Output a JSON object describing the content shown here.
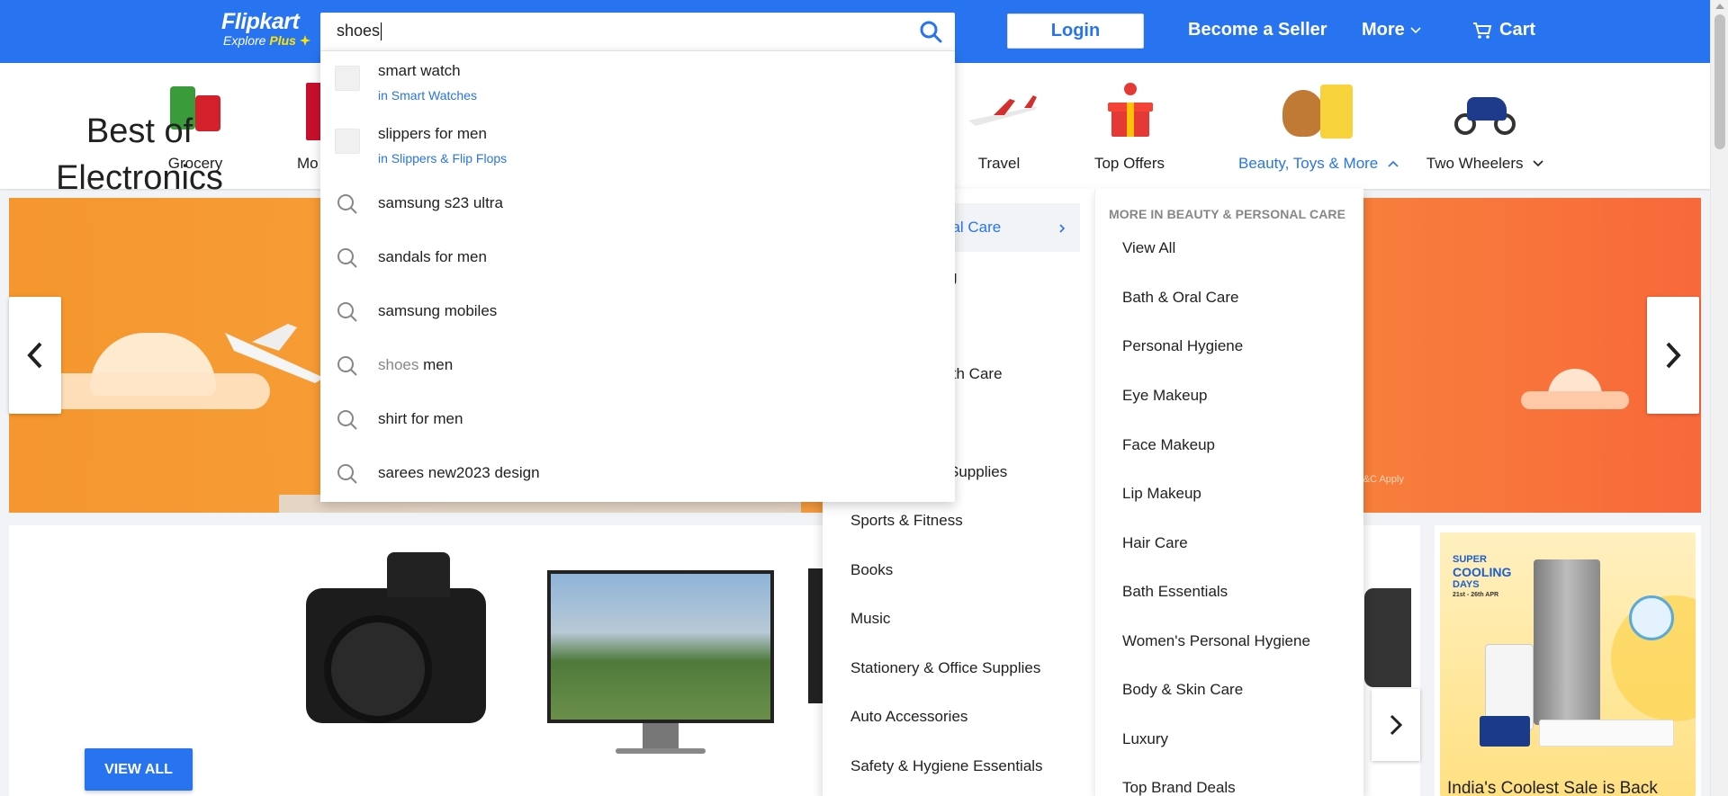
{
  "header": {
    "logo": "Flipkart",
    "logo_tagline": "Explore",
    "logo_plus": "Plus",
    "login_label": "Login",
    "seller_label": "Become a Seller",
    "more_label": "More",
    "cart_label": "Cart",
    "brand_color": "#2874f0"
  },
  "search": {
    "value": "shoes",
    "suggestions": [
      {
        "text": "smart watch",
        "sub": "in Smart Watches",
        "icon": "product-thumb"
      },
      {
        "text": "slippers for men",
        "sub": "in Slippers & Flip Flops",
        "icon": "product-thumb"
      },
      {
        "text": "samsung s23 ultra",
        "icon": "search-icon"
      },
      {
        "text": "sandals for men",
        "icon": "search-icon"
      },
      {
        "text": "samsung mobiles",
        "icon": "search-icon"
      },
      {
        "typed": "shoes",
        "text": "men",
        "icon": "search-icon"
      },
      {
        "text": "shirt for men",
        "icon": "search-icon"
      },
      {
        "text": "sarees new2023 design",
        "icon": "search-icon"
      }
    ]
  },
  "categories": [
    {
      "label": "Grocery"
    },
    {
      "label": "Mo"
    },
    {
      "label": "Travel"
    },
    {
      "label": "Top Offers"
    },
    {
      "label": "Beauty, Toys & More"
    },
    {
      "label": "Two Wheelers"
    }
  ],
  "flyout": {
    "left_items": [
      {
        "label": "nal Care"
      },
      {
        "label": "g"
      },
      {
        "label": "lth Care"
      },
      {
        "label": "Supplies"
      },
      {
        "label": "Sports & Fitness"
      },
      {
        "label": "Books"
      },
      {
        "label": "Music"
      },
      {
        "label": "Stationery & Office Supplies"
      },
      {
        "label": "Auto Accessories"
      },
      {
        "label": "Safety & Hygiene Essentials"
      }
    ],
    "right_heading": "MORE IN BEAUTY & PERSONAL CARE",
    "right_items": [
      "View All",
      "Bath & Oral Care",
      "Personal Hygiene",
      "Eye Makeup",
      "Face Makeup",
      "Lip Makeup",
      "Hair Care",
      "Bath Essentials",
      "Women's Personal Hygiene",
      "Body & Skin Care",
      "Luxury",
      "Top Brand Deals"
    ]
  },
  "banner": {
    "tc": "T&C Apply"
  },
  "electronics": {
    "title_line1": "Best of",
    "title_line2": "Electronics",
    "view_all": "VIEW ALL"
  },
  "promo": {
    "line1": "SUPER",
    "line2": "COOLING",
    "line3": "DAYS",
    "dates": "21st - 26th APR",
    "caption": "India's Coolest Sale is Back"
  }
}
